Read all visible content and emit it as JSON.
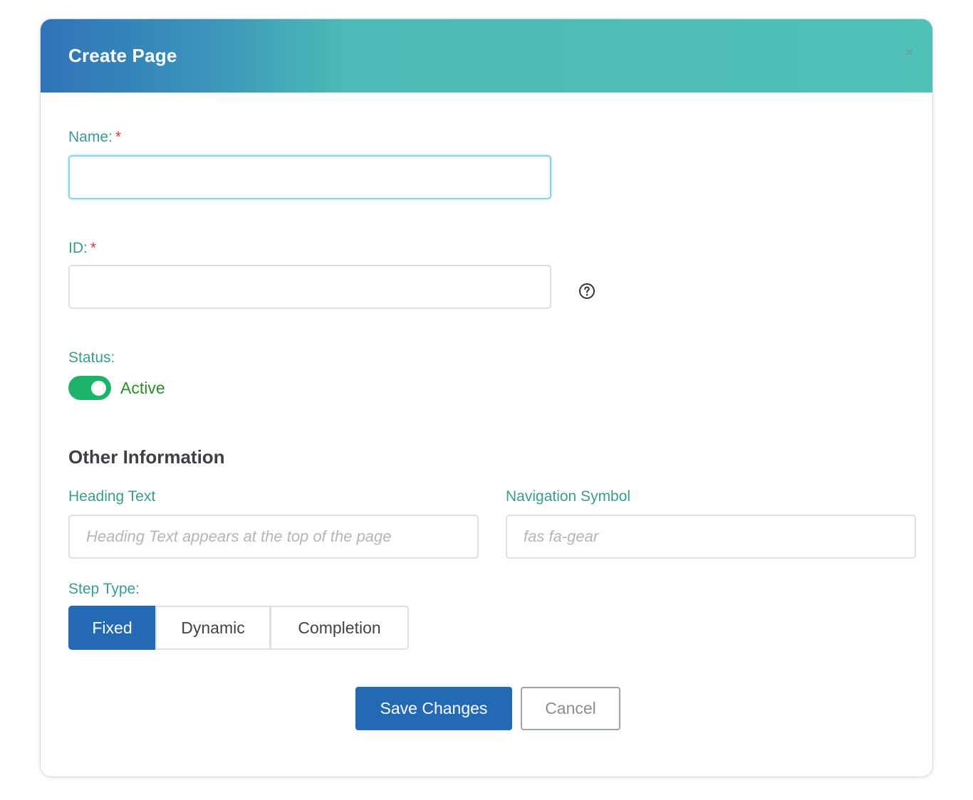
{
  "modal": {
    "title": "Create Page",
    "close_label": "×"
  },
  "fields": {
    "name": {
      "label": "Name:",
      "required_mark": "*",
      "value": ""
    },
    "id": {
      "label": "ID:",
      "required_mark": "*",
      "value": ""
    },
    "status": {
      "label": "Status:",
      "toggle_on": true,
      "toggle_text": "Active"
    }
  },
  "other_info": {
    "title": "Other Information",
    "heading_text": {
      "label": "Heading Text",
      "placeholder": "Heading Text appears at the top of the page",
      "value": ""
    },
    "navigation_symbol": {
      "label": "Navigation Symbol",
      "placeholder": "fas fa-gear",
      "value": ""
    }
  },
  "step_type": {
    "label": "Step Type:",
    "options": [
      "Fixed",
      "Dynamic",
      "Completion"
    ],
    "selected": "Fixed"
  },
  "actions": {
    "save_label": "Save Changes",
    "cancel_label": "Cancel"
  },
  "icons": {
    "help": "question-circle-icon",
    "close": "close-icon"
  },
  "colors": {
    "accent_blue": "#2369b3",
    "label_teal": "#3c9a8f",
    "toggle_green": "#1cb36b",
    "required_red": "#e0352b"
  }
}
